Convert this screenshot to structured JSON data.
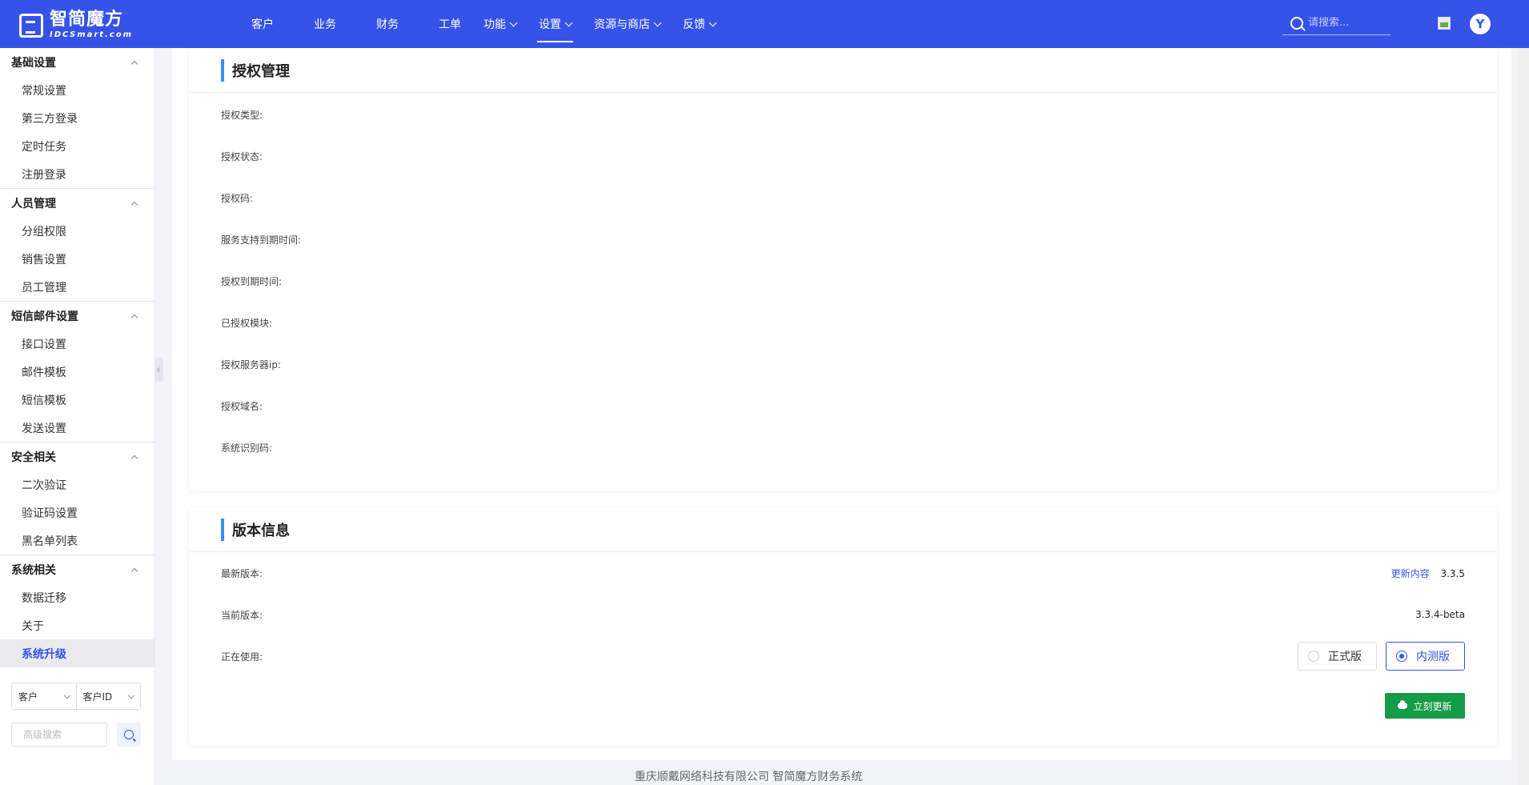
{
  "header": {
    "logo_cn": "智简魔方",
    "logo_en": "IDCSmart.com",
    "nav": [
      {
        "label": "客户",
        "dropdown": false,
        "active": false
      },
      {
        "label": "业务",
        "dropdown": false,
        "active": false
      },
      {
        "label": "财务",
        "dropdown": false,
        "active": false
      },
      {
        "label": "工单",
        "dropdown": false,
        "active": false
      },
      {
        "label": "功能",
        "dropdown": true,
        "active": false
      },
      {
        "label": "设置",
        "dropdown": true,
        "active": true
      },
      {
        "label": "资源与商店",
        "dropdown": true,
        "active": false
      },
      {
        "label": "反馈",
        "dropdown": true,
        "active": false
      }
    ],
    "search_placeholder": "请搜索...",
    "avatar_letter": "Y",
    "accent_color": "#3553e8"
  },
  "sidebar": {
    "groups": [
      {
        "title": "基础设置",
        "items": [
          "常规设置",
          "第三方登录",
          "定时任务",
          "注册登录"
        ]
      },
      {
        "title": "人员管理",
        "items": [
          "分组权限",
          "销售设置",
          "员工管理"
        ]
      },
      {
        "title": "短信邮件设置",
        "items": [
          "接口设置",
          "邮件模板",
          "短信模板",
          "发送设置"
        ]
      },
      {
        "title": "安全相关",
        "items": [
          "二次验证",
          "验证码设置",
          "黑名单列表"
        ]
      },
      {
        "title": "系统相关",
        "items": [
          "数据迁移",
          "关于",
          "系统升级"
        ]
      }
    ],
    "active_item": "系统升级",
    "filter_select_1": "客户",
    "filter_select_2": "客户ID",
    "advanced_search_placeholder": "高级搜索"
  },
  "license": {
    "title": "授权管理",
    "rows": [
      {
        "label": "授权类型:"
      },
      {
        "label": "授权状态:"
      },
      {
        "label": "授权码:"
      },
      {
        "label": "服务支持到期时间:"
      },
      {
        "label": "授权到期时间:"
      },
      {
        "label": "已授权模块:"
      },
      {
        "label": "授权服务器ip:"
      },
      {
        "label": "授权域名:"
      },
      {
        "label": "系统识别码:"
      }
    ]
  },
  "version": {
    "title": "版本信息",
    "latest_label": "最新版本:",
    "latest_link": "更新内容",
    "latest_value": "3.3.5",
    "current_label": "当前版本:",
    "current_value": "3.3.4-beta",
    "using_label": "正在使用:",
    "options": [
      {
        "label": "正式版",
        "checked": false
      },
      {
        "label": "内测版",
        "checked": true
      }
    ],
    "update_button": "立刻更新",
    "update_button_color": "#159c46"
  },
  "footer": "重庆顺戴网络科技有限公司 智简魔方财务系统"
}
